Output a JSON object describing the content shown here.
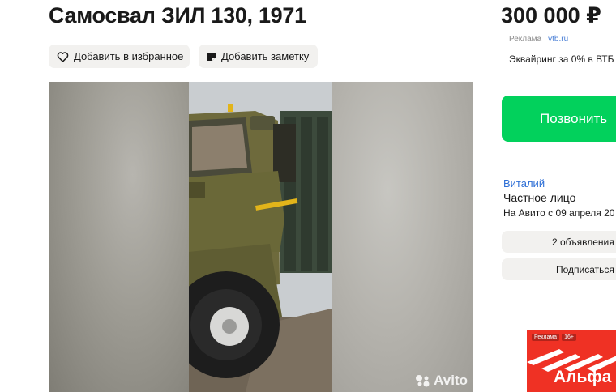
{
  "listing": {
    "title": "Самосвал ЗИЛ 130, 1971",
    "price": "300 000 ₽"
  },
  "actions": {
    "favorite_label": "Добавить в избранное",
    "note_label": "Добавить заметку"
  },
  "gallery": {
    "watermark": "Avito"
  },
  "ad": {
    "label": "Реклама",
    "domain": "vtb.ru",
    "text": "Эквайринг за 0% в ВТБ"
  },
  "contact": {
    "call_label": "Позвонить"
  },
  "seller": {
    "name": "Виталий",
    "type": "Частное лицо",
    "since": "На Авито с 09 апреля 20"
  },
  "seller_actions": {
    "listings_label": "2 объявления",
    "subscribe_label": "Подписаться"
  },
  "banner": {
    "tag": "Реклама",
    "age": "16+",
    "brand": "Альфа"
  },
  "colors": {
    "call_green": "#02d15c",
    "link_blue": "#2e6fd6",
    "banner_red": "#ef3124",
    "chip_bg": "#f2f1ef"
  },
  "icons": {
    "favorite": "heart-icon",
    "note": "note-icon",
    "watermark": "avito-logo-icon"
  }
}
